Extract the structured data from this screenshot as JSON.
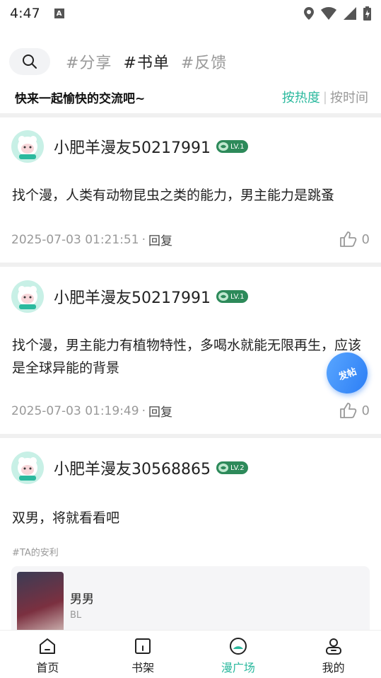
{
  "status": {
    "time": "4:47"
  },
  "topbar": {
    "tags": [
      "#分享",
      "#书单",
      "#反馈"
    ],
    "active_tag": 1
  },
  "subbar": {
    "slogan": "快来一起愉快的交流吧~",
    "sort_hot": "按热度",
    "sort_sep": "|",
    "sort_time": "按时间"
  },
  "posts": [
    {
      "username": "小肥羊漫友50217991",
      "level": "LV.1",
      "content": "找个漫，人类有动物昆虫之类的能力，男主能力是跳蚤",
      "date": "2025-07-03 01:21:51",
      "dot": "·",
      "reply": "回复",
      "likes": "0"
    },
    {
      "username": "小肥羊漫友50217991",
      "level": "LV.1",
      "content": "找个漫，男主能力有植物特性，多喝水就能无限再生，应该是全球异能的背景",
      "date": "2025-07-03 01:19:49",
      "dot": "·",
      "reply": "回复",
      "likes": "0"
    },
    {
      "username": "小肥羊漫友30568865",
      "level": "LV.2",
      "content": "双男，将就看看吧",
      "ta_label": "#TA的安利",
      "rec_title": "男男",
      "rec_tag": "BL"
    }
  ],
  "fab": {
    "label": "发帖"
  },
  "tabbar": {
    "items": [
      {
        "label": "首页",
        "icon": "home-icon"
      },
      {
        "label": "书架",
        "icon": "bookshelf-icon"
      },
      {
        "label": "漫广场",
        "icon": "plaza-icon"
      },
      {
        "label": "我的",
        "icon": "profile-icon"
      }
    ],
    "active": 2
  },
  "colors": {
    "accent": "#2bb99e",
    "level_badge": "#2d8a5a",
    "fab": "#2b7df5"
  }
}
